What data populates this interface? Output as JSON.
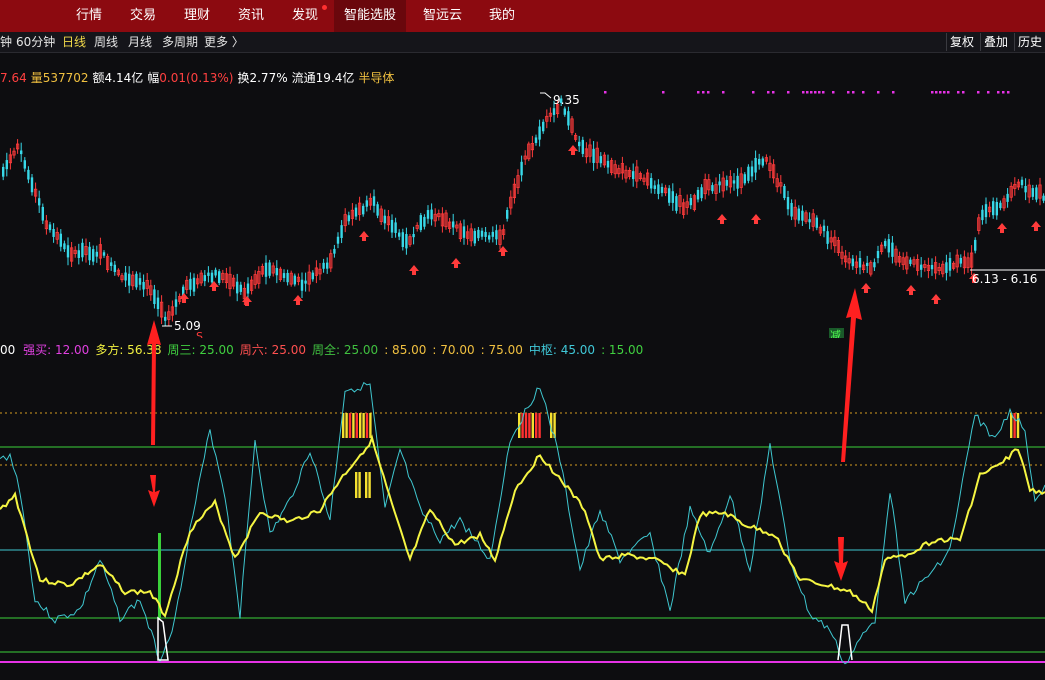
{
  "topnav": {
    "items": [
      "行情",
      "交易",
      "理财",
      "资讯",
      "发现",
      "智能选股",
      "智远云",
      "我的"
    ],
    "active": "智能选股",
    "dot_on": "发现"
  },
  "periods": {
    "items": [
      "钟",
      "60分钟",
      "日线",
      "周线",
      "月线",
      "多周期",
      "更多 〉"
    ],
    "selected": "日线",
    "right_buttons": [
      "复权",
      "叠加",
      "历史"
    ]
  },
  "info": {
    "price": "7.64",
    "volume": "量537702",
    "amount": "额4.14亿",
    "change_label": "幅",
    "change": "0.01(0.13%)",
    "turnover": "换2.77%",
    "float": "流通19.4亿",
    "sector": "半导体"
  },
  "price_labels": {
    "high": "9.35",
    "low": "5.09",
    "range": "6.13 - 6.16",
    "marker_s": "S",
    "marker_jian": "减"
  },
  "indicator": {
    "lead": "00",
    "items": [
      {
        "label": "强买:",
        "value": "12.00",
        "color": "#e040e0"
      },
      {
        "label": "多方:",
        "value": "56.38",
        "color": "#f0f040"
      },
      {
        "label": "周三:",
        "value": "25.00",
        "color": "#40d040"
      },
      {
        "label": "周六:",
        "value": "25.00",
        "color": "#ff5050"
      },
      {
        "label": "周全:",
        "value": "25.00",
        "color": "#40c040"
      },
      {
        "label": ":",
        "value": "85.00",
        "color": "#f0c040"
      },
      {
        "label": ":",
        "value": "70.00",
        "color": "#f0c040"
      },
      {
        "label": ":",
        "value": "75.00",
        "color": "#f0c040"
      },
      {
        "label": "中枢:",
        "value": "45.00",
        "color": "#40c8d8"
      },
      {
        "label": ":",
        "value": "15.00",
        "color": "#40d040"
      }
    ]
  },
  "colors": {
    "up": "#ff3b3b",
    "down": "#38d8e8",
    "yellow": "#f5f542",
    "cyan": "#3fc7d0",
    "green": "#3ad13a",
    "magenta": "#e632e6",
    "orange": "#e8a030"
  }
}
